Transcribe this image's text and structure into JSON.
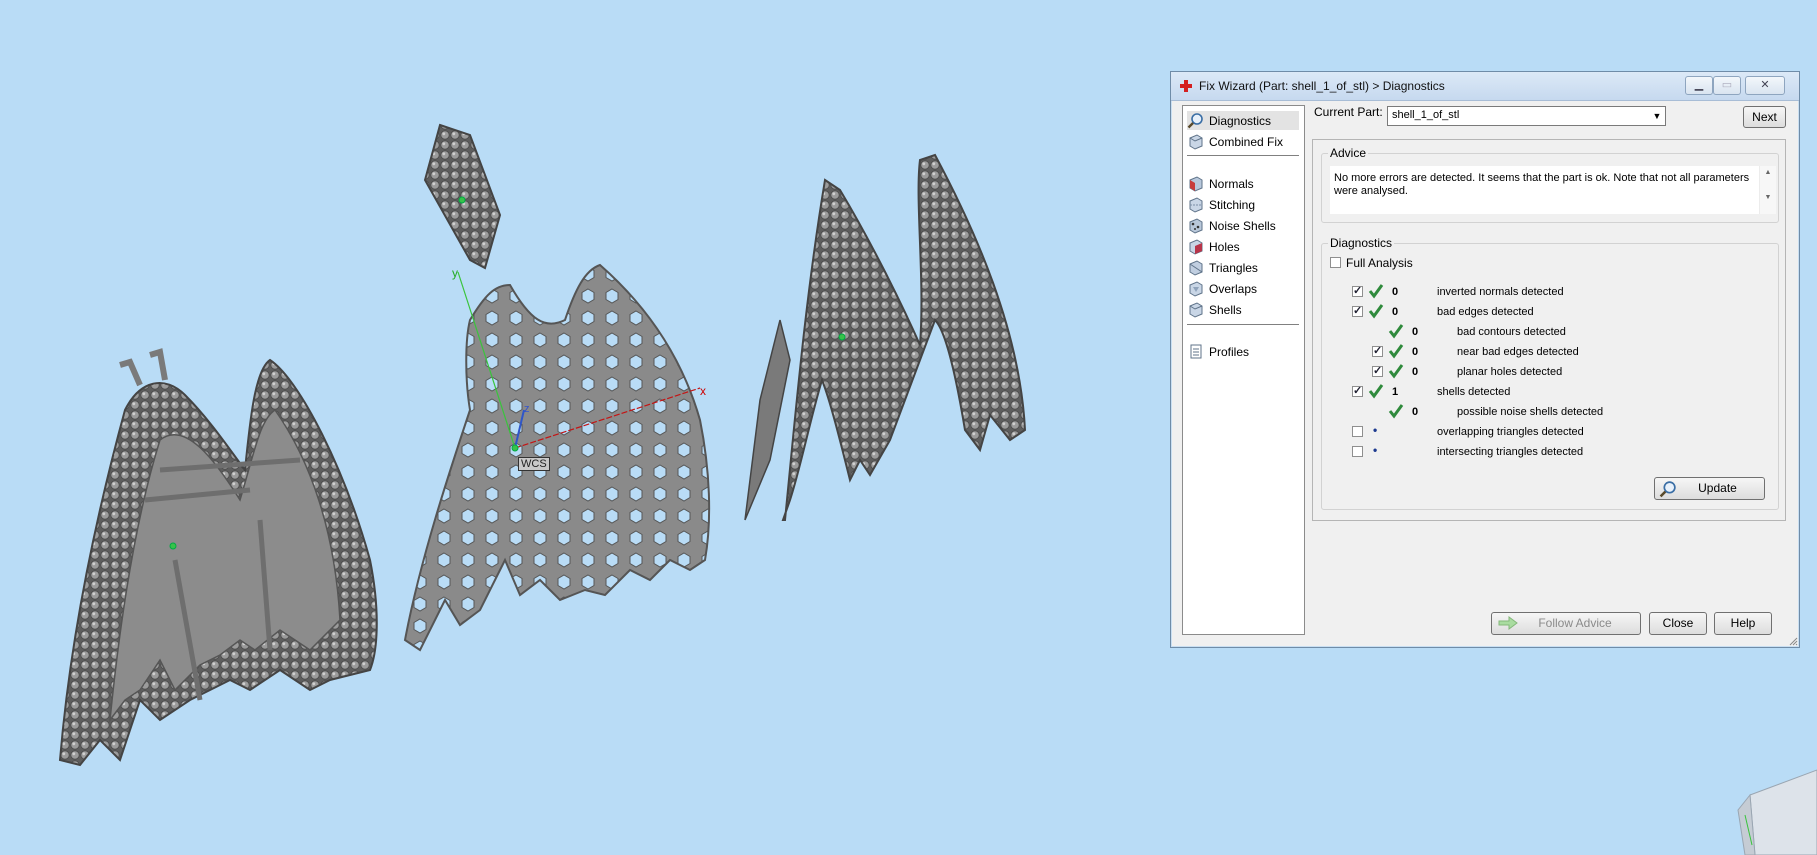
{
  "viewport": {
    "wcs_label": "WCS",
    "axis_x": "x",
    "axis_y": "y",
    "axis_z": "z"
  },
  "dialog": {
    "title": "Fix Wizard (Part: shell_1_of_stl) > Diagnostics",
    "nav": [
      {
        "label": "Diagnostics",
        "icon": "magnifier-icon",
        "active": true
      },
      {
        "label": "Combined Fix",
        "icon": "cube-icon"
      },
      {
        "label": "Normals",
        "icon": "normals-cube-icon"
      },
      {
        "label": "Stitching",
        "icon": "stitching-cube-icon"
      },
      {
        "label": "Noise Shells",
        "icon": "noise-shells-icon"
      },
      {
        "label": "Holes",
        "icon": "holes-cube-icon"
      },
      {
        "label": "Triangles",
        "icon": "triangles-cube-icon"
      },
      {
        "label": "Overlaps",
        "icon": "overlaps-cube-icon"
      },
      {
        "label": "Shells",
        "icon": "shells-cube-icon"
      },
      {
        "label": "Profiles",
        "icon": "document-icon"
      }
    ],
    "current_part_label": "Current Part:",
    "current_part_value": "shell_1_of_stl",
    "next_label": "Next",
    "advice_title": "Advice",
    "advice_text": "No more errors are detected. It seems that the part is ok. Note that not all parameters were analysed.",
    "diagnostics_title": "Diagnostics",
    "full_analysis_label": "Full Analysis",
    "full_analysis_checked": false,
    "rows": [
      {
        "checked": true,
        "status": "ok",
        "count": "0",
        "label": "inverted normals detected",
        "indent": 0
      },
      {
        "checked": true,
        "status": "ok",
        "count": "0",
        "label": "bad edges detected",
        "indent": 0
      },
      {
        "checked": null,
        "status": "ok",
        "count": "0",
        "label": "bad contours detected",
        "indent": 1
      },
      {
        "checked": true,
        "status": "ok",
        "count": "0",
        "label": "near bad edges detected",
        "indent": 1
      },
      {
        "checked": true,
        "status": "ok",
        "count": "0",
        "label": "planar holes detected",
        "indent": 1
      },
      {
        "checked": true,
        "status": "ok",
        "count": "1",
        "label": "shells detected",
        "indent": 0
      },
      {
        "checked": null,
        "status": "ok",
        "count": "0",
        "label": "possible noise shells detected",
        "indent": 1
      },
      {
        "checked": false,
        "status": "dot",
        "count": "",
        "label": "overlapping triangles detected",
        "indent": 0
      },
      {
        "checked": false,
        "status": "dot",
        "count": "",
        "label": "intersecting triangles detected",
        "indent": 0
      }
    ],
    "update_label": "Update",
    "follow_advice_label": "Follow Advice",
    "close_label": "Close",
    "help_label": "Help"
  },
  "colors": {
    "background": "#b9dcf6",
    "model": "#7d7d7d",
    "ok_check": "#2f8a3c"
  }
}
